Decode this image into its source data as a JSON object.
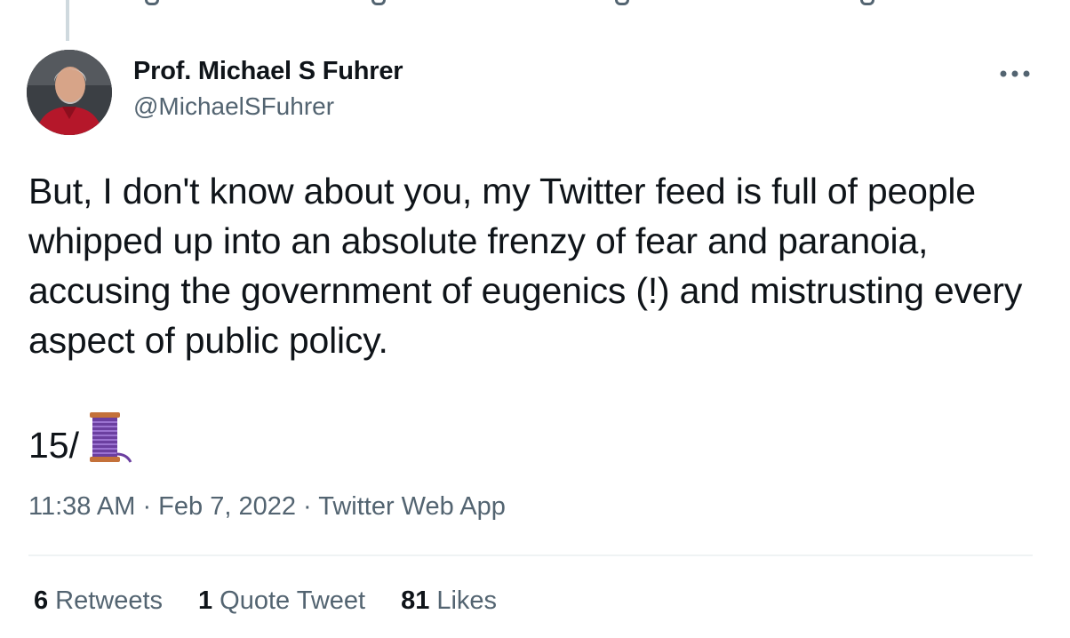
{
  "author": {
    "name": "Prof. Michael S Fuhrer",
    "handle": "@MichaelSFuhrer"
  },
  "tweet": {
    "text": "But, I don't know about you, my Twitter feed is full of people whipped up into an absolute frenzy of fear and paranoia, accusing the government of eugenics (!) and mistrusting every aspect of public policy.",
    "thread_counter": "15/",
    "thread_emoji_icon": "spool-of-thread-icon"
  },
  "meta": {
    "time": "11:38 AM",
    "separator": " · ",
    "date": "Feb 7, 2022",
    "source": "Twitter Web App"
  },
  "stats": {
    "retweets_count": "6",
    "retweets_label": "Retweets",
    "quotes_count": "1",
    "quotes_label": "Quote Tweet",
    "likes_count": "81",
    "likes_label": "Likes"
  },
  "colors": {
    "text_primary": "#0f1419",
    "text_secondary": "#536471",
    "divider": "#eff3f4",
    "thread_line": "#cfd9de"
  }
}
